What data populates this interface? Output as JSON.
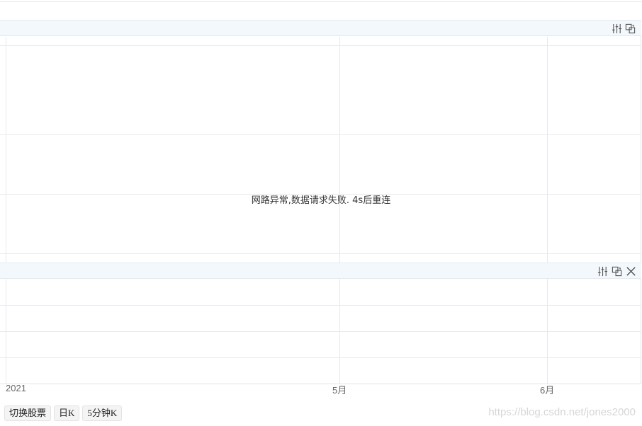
{
  "chart": {
    "status_message": "网路异常,数据请求失败. 4s后重连",
    "x_axis_ticks": [
      "2021",
      "5月",
      "6月"
    ]
  },
  "main_panel": {
    "icons": [
      "settings-sliders-icon",
      "switch-overlay-icon"
    ]
  },
  "sub_panel": {
    "icons": [
      "settings-sliders-icon",
      "switch-overlay-icon",
      "close-icon"
    ]
  },
  "toolbar": {
    "buttons": [
      "切换股票",
      "日K",
      "5分钟K"
    ]
  },
  "watermark": "https://blog.csdn.net/jones2000",
  "colors": {
    "header_bg": "#f3f8fc",
    "grid": "#e4e9ee",
    "axis_text": "#666666",
    "icon": "#555555"
  }
}
